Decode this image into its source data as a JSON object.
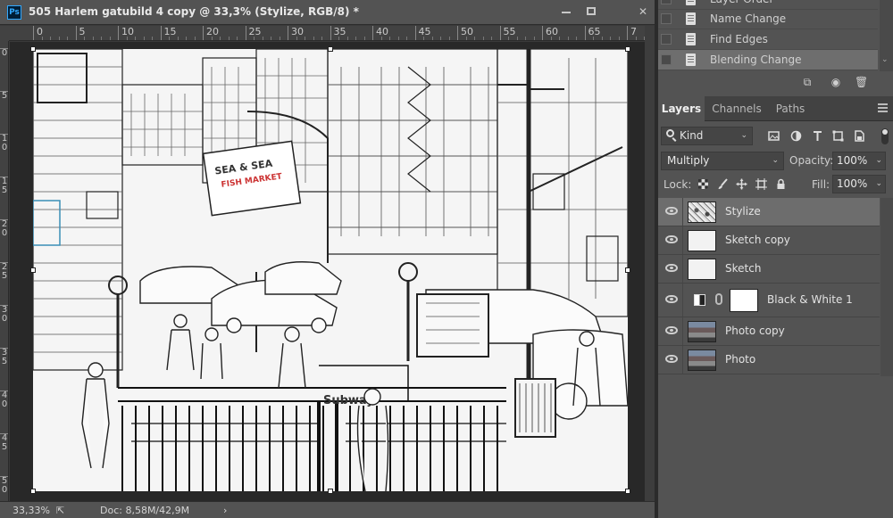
{
  "document": {
    "app_badge": "Ps",
    "title": "505 Harlem gatubild 4 copy @ 33,3% (Stylize, RGB/8) *",
    "ruler_h": [
      "0",
      "5",
      "10",
      "15",
      "20",
      "25",
      "30",
      "35",
      "40",
      "45",
      "50",
      "55",
      "60",
      "65",
      "7"
    ],
    "ruler_v": [
      "0",
      "5",
      "1 0",
      "1 5",
      "2 0",
      "2 5",
      "3 0",
      "3 5",
      "4 0",
      "4 5",
      "5 0"
    ],
    "status": {
      "zoom": "33,33%",
      "doc_size": "Doc: 8,58M/42,9M",
      "arrow": "›"
    },
    "canvas_signs": [
      "SEA & SEA",
      "FISH MARKET",
      "Subway"
    ]
  },
  "history": {
    "items": [
      {
        "label": "Layer Order"
      },
      {
        "label": "Name Change"
      },
      {
        "label": "Find Edges"
      },
      {
        "label": "Blending Change",
        "selected": true
      }
    ]
  },
  "layers_panel": {
    "tabs": [
      "Layers",
      "Channels",
      "Paths"
    ],
    "active_tab": "Layers",
    "filter_kind": "Kind",
    "blend_mode": "Multiply",
    "opacity_label": "Opacity:",
    "opacity": "100%",
    "lock_label": "Lock:",
    "fill_label": "Fill:",
    "fill": "100%",
    "layers": [
      {
        "name": "Stylize",
        "visible": true,
        "selected": true,
        "thumb": "stylize"
      },
      {
        "name": "Sketch copy",
        "visible": true,
        "thumb": "sketch"
      },
      {
        "name": "Sketch",
        "visible": true,
        "thumb": "sketch"
      },
      {
        "name": "Black & White 1",
        "visible": true,
        "thumb": "adjustment"
      },
      {
        "name": "Photo copy",
        "visible": true,
        "thumb": "photo"
      },
      {
        "name": "Photo",
        "visible": true,
        "thumb": "photo"
      }
    ]
  },
  "colors": {
    "panel_bg": "#535353",
    "canvas_bg": "#282828",
    "selected_row": "#6d6d6d",
    "ps_blue": "#31a8ff"
  }
}
